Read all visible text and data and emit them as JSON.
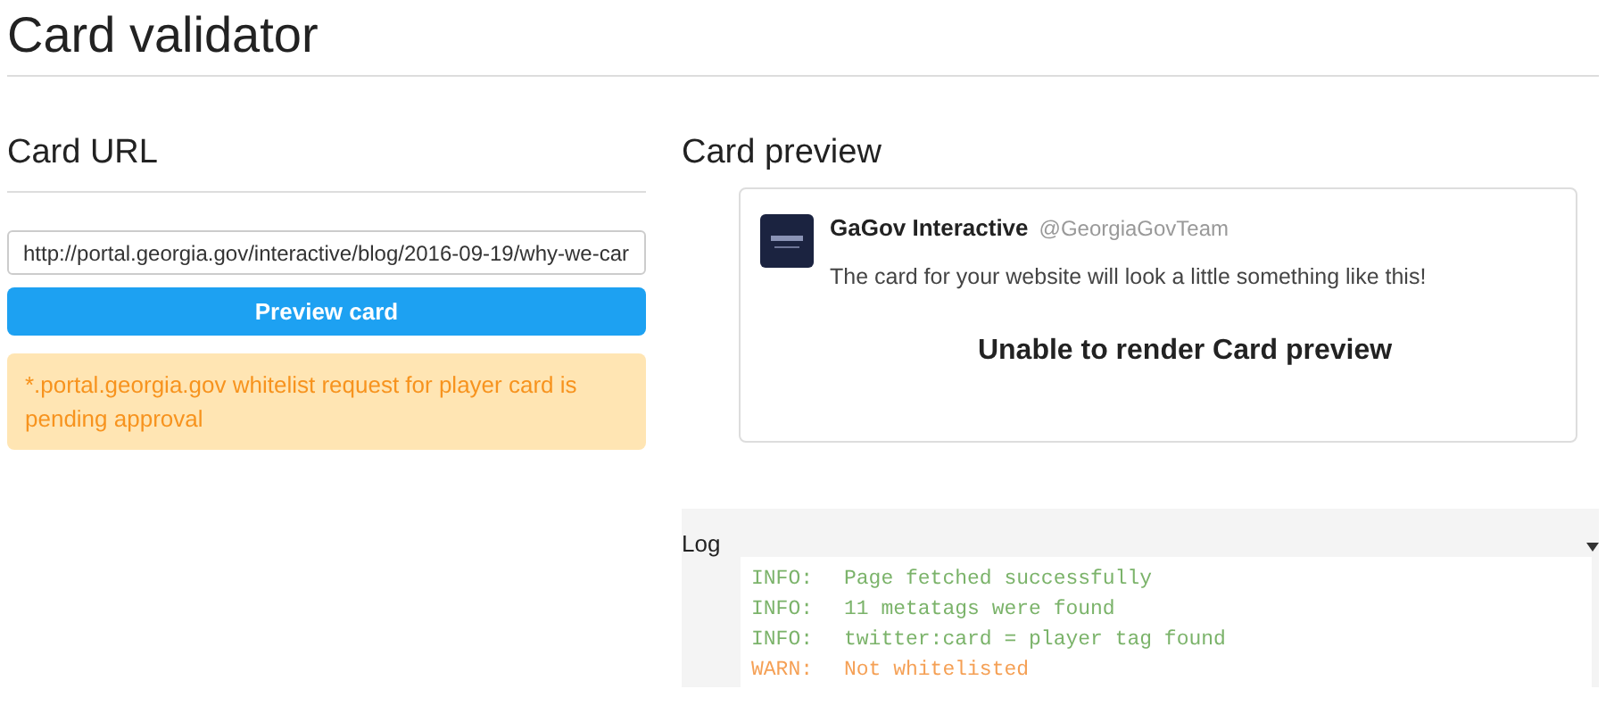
{
  "title": "Card validator",
  "card_url": {
    "heading": "Card URL",
    "url_value": "http://portal.georgia.gov/interactive/blog/2016-09-19/why-we-car",
    "button": "Preview card",
    "alert": "*.portal.georgia.gov whitelist request for player card is pending approval"
  },
  "card_preview": {
    "heading": "Card preview",
    "account_name": "GaGov Interactive",
    "handle": "@GeorgiaGovTeam",
    "text": "The card for your website will look a little something like this!",
    "message": "Unable to render Card preview"
  },
  "log": {
    "label": "Log",
    "entries": [
      {
        "kind": "info",
        "level": "INFO:",
        "message": "Page fetched successfully"
      },
      {
        "kind": "info",
        "level": "INFO:",
        "message": "11 metatags were found"
      },
      {
        "kind": "info",
        "level": "INFO:",
        "message": "twitter:card = player tag found"
      },
      {
        "kind": "warn",
        "level": "WARN:",
        "message": "Not whitelisted"
      }
    ]
  }
}
